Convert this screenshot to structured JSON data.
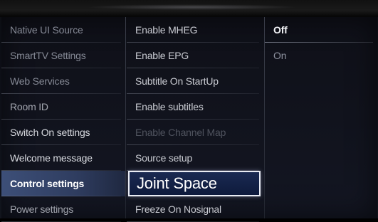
{
  "menu": {
    "left": [
      {
        "label": "Native UI Source",
        "state": "dim"
      },
      {
        "label": "SmartTV Settings",
        "state": "dim"
      },
      {
        "label": "Web Services",
        "state": "dim"
      },
      {
        "label": "Room ID",
        "state": "normal"
      },
      {
        "label": "Switch On settings",
        "state": "bright"
      },
      {
        "label": "Welcome message",
        "state": "bright"
      },
      {
        "label": "Control settings",
        "state": "active"
      },
      {
        "label": "Power settings",
        "state": "normal"
      }
    ],
    "middle": [
      {
        "label": "Enable MHEG",
        "state": "normal"
      },
      {
        "label": "Enable EPG",
        "state": "normal"
      },
      {
        "label": "Subtitle On StartUp",
        "state": "normal"
      },
      {
        "label": "Enable subtitles",
        "state": "normal"
      },
      {
        "label": "Enable Channel Map",
        "state": "disabled"
      },
      {
        "label": "Source setup",
        "state": "normal"
      },
      {
        "label": "Joint Space",
        "state": "focused"
      },
      {
        "label": "Freeze On Nosignal",
        "state": "normal"
      }
    ],
    "right": [
      {
        "label": "Off",
        "state": "selected"
      },
      {
        "label": "On",
        "state": "normal"
      }
    ]
  }
}
